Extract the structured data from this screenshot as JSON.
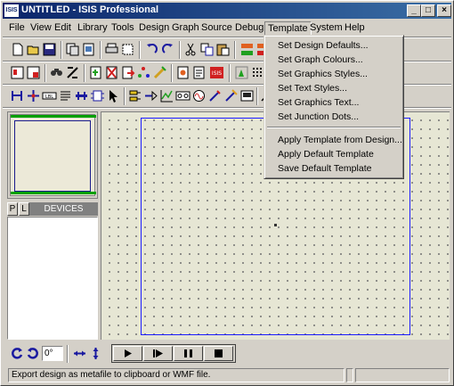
{
  "window": {
    "icon_text": "ISIS",
    "title": "UNTITLED - ISIS Professional",
    "minimize": "_",
    "maximize": "□",
    "close": "×"
  },
  "menubar": {
    "items": [
      "File",
      "View",
      "Edit",
      "Library",
      "Tools",
      "Design",
      "Graph",
      "Source",
      "Debug",
      "Template",
      "System",
      "Help"
    ],
    "active": "Template"
  },
  "template_menu": {
    "items": [
      "Set Design Defaults...",
      "Set Graph Colours...",
      "Set Graphics Styles...",
      "Set Text Styles...",
      "Set Graphics Text...",
      "Set Junction Dots...",
      "Apply Template from Design...",
      "Apply Default Template",
      "Save Default Template"
    ]
  },
  "toolbars": {
    "row1_icons": [
      "new-icon",
      "open-icon",
      "save-icon",
      "import-icon",
      "export-icon",
      "print-icon",
      "print-area-icon",
      "undo-icon",
      "redo-icon",
      "cut-icon",
      "copy-icon",
      "paste-icon",
      "block-copy-icon",
      "block-move-icon"
    ],
    "row2_icons": [
      "redraw-icon",
      "netlist-icon",
      "search-icon",
      "property-tool-icon",
      "new-sheet-icon",
      "remove-sheet-icon",
      "exit-to-parent-icon",
      "bom-icon",
      "erc-icon",
      "ares-icon",
      "grid-icon"
    ],
    "row3_icons": [
      "component-icon",
      "junction-icon",
      "wire-label-icon",
      "text-script-icon",
      "bus-icon",
      "subcircuit-icon",
      "select-icon",
      "terminal-icon",
      "pin-icon",
      "graph-icon",
      "tape-icon",
      "generator-icon",
      "voltage-probe-icon",
      "current-probe-icon",
      "virtual-instrument-icon",
      "line-icon"
    ]
  },
  "left_panel": {
    "p_button": "P",
    "l_button": "L",
    "devices_label": "DEVICES"
  },
  "bottom": {
    "rotation_value": "0°",
    "sim_controls": [
      "play",
      "step",
      "pause",
      "stop"
    ]
  },
  "status": {
    "message": "Export design as metafile to clipboard or WMF file."
  },
  "colors": {
    "title_bar": "#0a246a",
    "canvas": "#e6e6d4",
    "sheet_border": "#1c1cff",
    "overview_green": "#00a000"
  }
}
